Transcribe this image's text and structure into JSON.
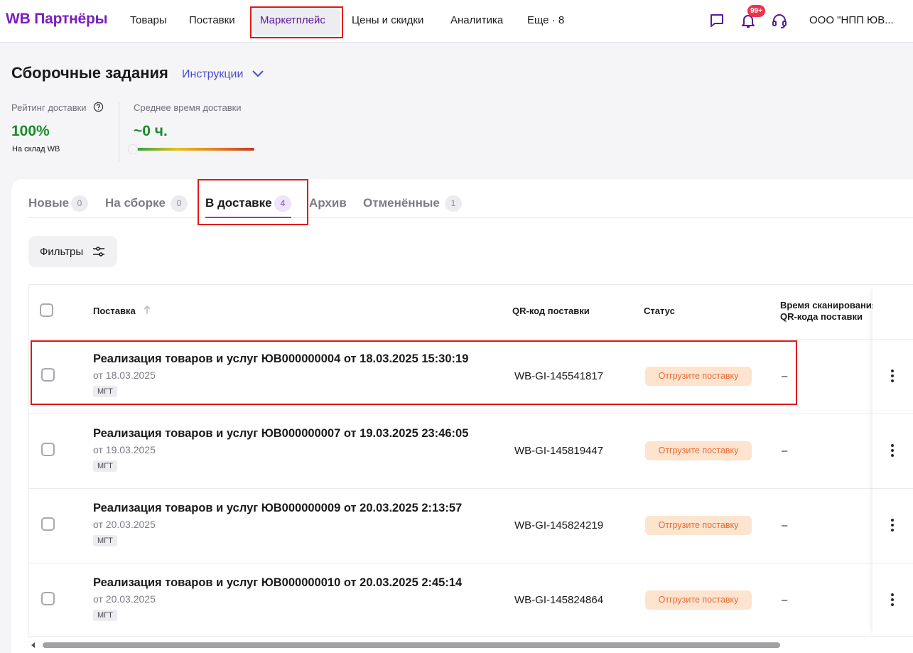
{
  "app": {
    "logo": "WB Партнёры",
    "nav": {
      "items": [
        "Товары",
        "Поставки",
        "Маркетплейс",
        "Цены и скидки",
        "Аналитика",
        "Еще · 8"
      ],
      "active": "Маркетплейс"
    },
    "notifications_badge": "99+",
    "company": "ООО \"НПП ЮВ..."
  },
  "page": {
    "title": "Сборочные задания",
    "instructions_link": "Инструкции"
  },
  "stats": {
    "rating_label": "Рейтинг доставки",
    "rating_value": "100%",
    "rating_sub": "На склад WB",
    "avg_time_label": "Среднее время доставки",
    "avg_time_value": "~0 ч.",
    "avg_time_level": 0
  },
  "tabs": [
    {
      "label": "Новые",
      "count": "0"
    },
    {
      "label": "На сборке",
      "count": "0"
    },
    {
      "label": "В доставке",
      "count": "4",
      "active": true
    },
    {
      "label": "Архив"
    },
    {
      "label": "Отменённые",
      "count": "1"
    }
  ],
  "filters": {
    "label": "Фильтры"
  },
  "table": {
    "columns": {
      "supply": "Поставка",
      "qr": "QR-код поставки",
      "status": "Статус",
      "scan_time_line1": "Время сканирования",
      "scan_time_line2": "QR-кода поставки"
    },
    "rows": [
      {
        "title": "Реализация товаров и услуг ЮВ000000004 от 18.03.2025 15:30:19",
        "date": "от 18.03.2025",
        "tag": "МГТ",
        "qr": "WB-GI-145541817",
        "status": "Отгрузите поставку",
        "scan": "–"
      },
      {
        "title": "Реализация товаров и услуг ЮВ000000007 от 19.03.2025 23:46:05",
        "date": "от 19.03.2025",
        "tag": "МГТ",
        "qr": "WB-GI-145819447",
        "status": "Отгрузите поставку",
        "scan": "–"
      },
      {
        "title": "Реализация товаров и услуг ЮВ000000009 от 20.03.2025 2:13:57",
        "date": "от 20.03.2025",
        "tag": "МГТ",
        "qr": "WB-GI-145824219",
        "status": "Отгрузите поставку",
        "scan": "–"
      },
      {
        "title": "Реализация товаров и услуг ЮВ000000010 от 20.03.2025 2:45:14",
        "date": "от 20.03.2025",
        "tag": "МГТ",
        "qr": "WB-GI-145824864",
        "status": "Отгрузите поставку",
        "scan": "–"
      }
    ]
  },
  "colors": {
    "brand": "#7a1ebf",
    "accent": "#8a3ad6",
    "success": "#1a8a2b",
    "status_bg": "#fde4cf",
    "status_text": "#e76a33",
    "highlight": "#e01818"
  },
  "icons": {
    "chat": "chat-icon",
    "bell": "bell-icon",
    "support": "headset-icon",
    "help": "help-circle-icon",
    "chevron": "chevron-down-icon",
    "filter": "sliders-icon",
    "sort": "arrow-up-icon",
    "more": "kebab-icon"
  }
}
